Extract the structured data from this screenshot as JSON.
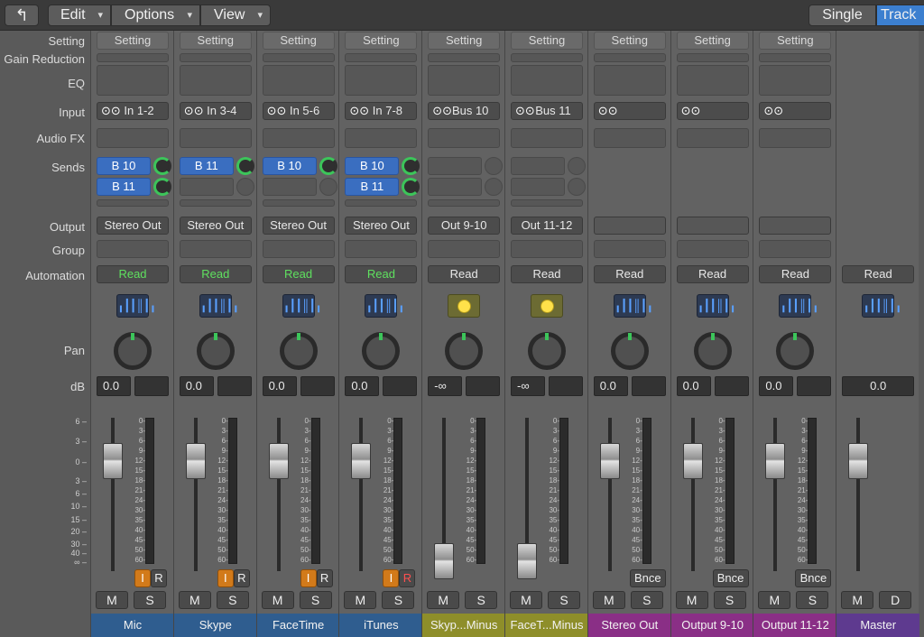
{
  "toolbar": {
    "back_icon": "↰",
    "edit": "Edit",
    "options": "Options",
    "view": "View",
    "single": "Single",
    "track": "Track"
  },
  "row_labels": {
    "setting": "Setting",
    "gain_reduction": "Gain Reduction",
    "eq": "EQ",
    "input": "Input",
    "audio_fx": "Audio FX",
    "sends": "Sends",
    "output": "Output",
    "group": "Group",
    "automation": "Automation",
    "pan": "Pan",
    "db": "dB"
  },
  "left_scale": [
    "6",
    "3",
    "0",
    "3",
    "6",
    "10",
    "15",
    "20",
    "30",
    "40",
    "∞"
  ],
  "meter_scale": [
    "0",
    "3",
    "6",
    "9",
    "12",
    "15",
    "18",
    "21",
    "24",
    "30",
    "35",
    "40",
    "45",
    "50",
    "60"
  ],
  "strips": [
    {
      "name": "Mic",
      "color": "#2f5d8f",
      "setting": "Setting",
      "input": "In 1-2",
      "sends": [
        "B 10",
        "B 11"
      ],
      "output": "Stereo Out",
      "automation": "Read",
      "read_green": true,
      "plugin": "waveform-icon",
      "db": "0.0",
      "fader": 0,
      "extra": "IR",
      "r_red": false,
      "m": "M",
      "s": "S"
    },
    {
      "name": "Skype",
      "color": "#2f5d8f",
      "setting": "Setting",
      "input": "In 3-4",
      "sends": [
        "B 11",
        ""
      ],
      "output": "Stereo Out",
      "automation": "Read",
      "read_green": true,
      "plugin": "waveform-icon",
      "db": "0.0",
      "fader": 0,
      "extra": "IR",
      "r_red": false,
      "m": "M",
      "s": "S"
    },
    {
      "name": "FaceTime",
      "color": "#2f5d8f",
      "setting": "Setting",
      "input": "In 5-6",
      "sends": [
        "B 10",
        ""
      ],
      "output": "Stereo Out",
      "automation": "Read",
      "read_green": true,
      "plugin": "waveform-icon",
      "db": "0.0",
      "fader": 0,
      "extra": "IR",
      "r_red": false,
      "m": "M",
      "s": "S"
    },
    {
      "name": "iTunes",
      "color": "#2f5d8f",
      "setting": "Setting",
      "input": "In 7-8",
      "sends": [
        "B 10",
        "B 11"
      ],
      "output": "Stereo Out",
      "automation": "Read",
      "read_green": true,
      "plugin": "waveform-icon",
      "db": "0.0",
      "fader": 0,
      "extra": "IR",
      "r_red": true,
      "m": "M",
      "s": "S"
    },
    {
      "name": "Skyp...Minus",
      "color": "#8e8e2a",
      "setting": "Setting",
      "input": "Bus 10",
      "sends": [
        "",
        ""
      ],
      "output": "Out 9-10",
      "automation": "Read",
      "read_green": false,
      "plugin": "gain-icon",
      "db": "-∞",
      "fader": 1,
      "extra": "",
      "r_red": false,
      "m": "M",
      "s": "S"
    },
    {
      "name": "FaceT...Minus",
      "color": "#8e8e2a",
      "setting": "Setting",
      "input": "Bus 11",
      "sends": [
        "",
        ""
      ],
      "output": "Out 11-12",
      "automation": "Read",
      "read_green": false,
      "plugin": "gain-icon",
      "db": "-∞",
      "fader": 1,
      "extra": "",
      "r_red": false,
      "m": "M",
      "s": "S"
    },
    {
      "name": "Stereo Out",
      "color": "#8a2f86",
      "setting": "Setting",
      "input": "",
      "sends": null,
      "output": "",
      "automation": "Read",
      "read_green": false,
      "plugin": "waveform-icon",
      "db": "0.0",
      "fader": 0,
      "extra": "Bnce",
      "r_red": false,
      "m": "M",
      "s": "S"
    },
    {
      "name": "Output 9-10",
      "color": "#8a2f86",
      "setting": "Setting",
      "input": "",
      "sends": null,
      "output": "",
      "automation": "Read",
      "read_green": false,
      "plugin": "waveform-icon",
      "db": "0.0",
      "fader": 0,
      "extra": "Bnce",
      "r_red": false,
      "m": "M",
      "s": "S"
    },
    {
      "name": "Output 11-12",
      "color": "#8a2f86",
      "setting": "Setting",
      "input": "",
      "sends": null,
      "output": "",
      "automation": "Read",
      "read_green": false,
      "plugin": "waveform-icon",
      "db": "0.0",
      "fader": 0,
      "extra": "Bnce",
      "r_red": false,
      "m": "M",
      "s": "S"
    },
    {
      "name": "Master",
      "color": "#5e3a8f",
      "setting": "",
      "input": null,
      "sends": null,
      "output": null,
      "automation": "Read",
      "read_green": false,
      "plugin": "waveform-icon",
      "db": "0.0",
      "fader": 0,
      "extra": "",
      "r_red": false,
      "m": "M",
      "s": "D",
      "master": true
    }
  ]
}
